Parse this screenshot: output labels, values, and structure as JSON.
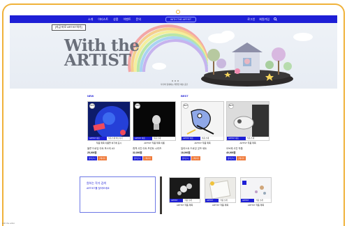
{
  "nav": {
    "menu": [
      "소개",
      "아티스트",
      "상품",
      "이벤트",
      "문의"
    ],
    "logo": "WITH THE ARTIST",
    "right": [
      "로그인",
      "회원가입"
    ]
  },
  "hero": {
    "button": "[지금 바로 ARTIST하기]",
    "title_line1": "With the",
    "title_line2": "ARTIST",
    "caption": "작가와 함께하는 특별한 예술 공간"
  },
  "sections": {
    "new_label": "NEW",
    "best_label": "BEST"
  },
  "products": [
    {
      "badge": "NEW",
      "tag_a": "ARTIST 이름",
      "tag_b": "작품 소개 바로가기",
      "caption": "작품 제목 이름을 여기에 표시",
      "desc": "블루 드로잉 아트 포스터 A3",
      "price": "25,000원",
      "btn1": "장바구니",
      "btn2": "구매하기"
    },
    {
      "badge": "NEW",
      "tag_a": "ARTIST 이름",
      "tag_b": "작품 소개",
      "caption": "ARTIST 작품 제목 이름",
      "desc": "흑백 사진 아트 프린트 시리즈",
      "price": "32,000원",
      "btn1": "장바구니",
      "btn2": "구매하기"
    },
    {
      "badge": "BEST",
      "tag_a": "ARTIST 이름",
      "tag_b": "작품 소개",
      "caption": "ARTIST 작품 제목",
      "desc": "일러스트 드로잉 굿즈 세트",
      "price": "18,000원",
      "btn1": "장바구니",
      "btn2": "구매하기"
    },
    {
      "badge": "BEST",
      "tag_a": "ARTIST 이름",
      "tag_b": "작품 소개",
      "caption": "ARTIST 작품 제목",
      "desc": "오브제 사진 작품",
      "price": "40,000원",
      "btn1": "장바구니",
      "btn2": "구매하기"
    }
  ],
  "promo": {
    "title": "원하는 작가 검색",
    "subtitle": "ARTIST를 찾아보세요"
  },
  "small_products": [
    {
      "tag_a": "ARTIST",
      "tag_b": "작품 소개",
      "caption": "ARTIST 작품 제목"
    },
    {
      "tag_a": "ARTIST",
      "tag_b": "작품 소개",
      "caption": "ARTIST 작품 제목"
    },
    {
      "tag_a": "ARTIST",
      "tag_b": "작품 소개",
      "caption": "ARTIST 작품 제목"
    }
  ],
  "footer_hint": "with the artist"
}
